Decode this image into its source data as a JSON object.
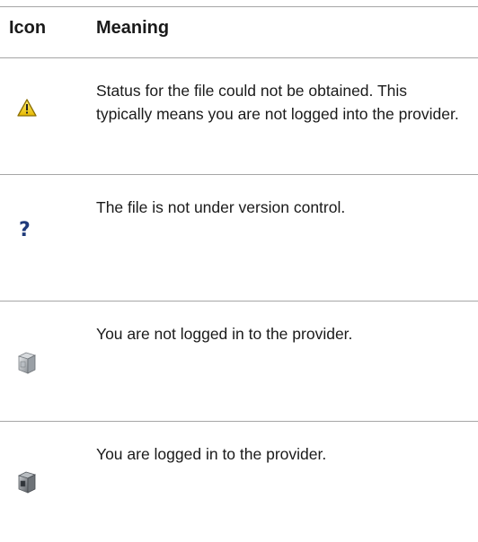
{
  "table": {
    "columns": {
      "icon": "Icon",
      "meaning": "Meaning"
    },
    "rows": [
      {
        "icon_name": "warning-triangle-icon",
        "meaning": "Status for the file could not be obtained. This typically means you are not logged into the provider."
      },
      {
        "icon_name": "question-mark-icon",
        "meaning": "The file is not under version control."
      },
      {
        "icon_name": "server-logged-out-icon",
        "meaning": "You are not logged in to the provider."
      },
      {
        "icon_name": "server-logged-in-icon",
        "meaning": "You are logged in to the provider."
      }
    ]
  },
  "colors": {
    "warning_fill": "#f2d21b",
    "question_mark": "#1f3a7a",
    "rule": "#a6a6a6"
  }
}
